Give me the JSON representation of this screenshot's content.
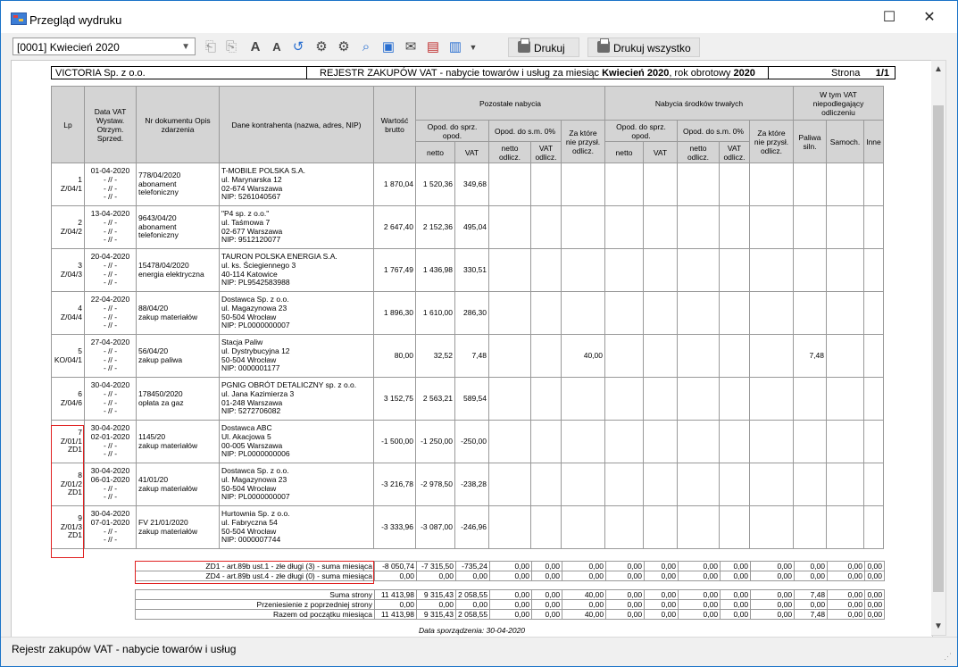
{
  "window": {
    "title": "Przegląd wydruku"
  },
  "toolbar": {
    "period_value": "[0001] Kwiecień 2020",
    "print_label": "Drukuj",
    "print_all_label": "Drukuj wszystko"
  },
  "report": {
    "company": "VICTORIA Sp. z o.o.",
    "title_prefix": "REJESTR ZAKUPÓW VAT - nabycie towarów i usług za miesiąc ",
    "title_month": "Kwiecień 2020",
    "title_mid": ", rok obrotowy ",
    "title_year": "2020",
    "page_label": "Strona",
    "page_value": "1/1",
    "headers": {
      "lp": "Lp",
      "date": "Data VAT Wystaw. Otrzym. Sprzed.",
      "doc": "Nr dokumentu Opis zdarzenia",
      "party": "Dane kontrahenta (nazwa, adres, NIP)",
      "gross": "Wartość brutto",
      "other": "Pozostałe nabycia",
      "assets": "Nabycia środków trwałych",
      "fuel_group": "W tym VAT niepodlegający odliczeniu",
      "opod": "Opod. do sprz. opod.",
      "sm0": "Opod. do s.m. 0%",
      "zakt": "Za które nie przysł. odlicz.",
      "netto": "netto",
      "vat": "VAT",
      "netto_odl": "netto odlicz.",
      "vat_odl": "VAT odlicz.",
      "paliwa": "Paliwa siln.",
      "samoch": "Samoch.",
      "inne": "Inne"
    },
    "rows": [
      {
        "lp": "1",
        "lp2": "Z/04/1",
        "lp3": "",
        "d1": "01-04-2020",
        "d2": "- // -",
        "d3": "- // -",
        "d4": "- // -",
        "doc": "778/04/2020",
        "desc1": "abonament",
        "desc2": "telefoniczny",
        "p1": "T-MOBILE POLSKA S.A.",
        "p2": "ul. Marynarska 12",
        "p3": "02-674 Warszawa",
        "p4": "NIP: 5261040567",
        "gross": "1 870,04",
        "netto": "1 520,36",
        "vat": "349,68",
        "zakt": "",
        "fuel": ""
      },
      {
        "lp": "2",
        "lp2": "Z/04/2",
        "lp3": "",
        "d1": "13-04-2020",
        "d2": "- // -",
        "d3": "- // -",
        "d4": "- // -",
        "doc": "9643/04/20",
        "desc1": "abonament",
        "desc2": "telefoniczny",
        "p1": "\"P4 sp. z o.o.\"",
        "p2": "ul. Taśmowa 7",
        "p3": "02-677 Warszawa",
        "p4": "NIP: 9512120077",
        "gross": "2 647,40",
        "netto": "2 152,36",
        "vat": "495,04",
        "zakt": "",
        "fuel": ""
      },
      {
        "lp": "3",
        "lp2": "Z/04/3",
        "lp3": "",
        "d1": "20-04-2020",
        "d2": "- // -",
        "d3": "- // -",
        "d4": "- // -",
        "doc": "15478/04/2020",
        "desc1": "energia elektryczna",
        "desc2": "",
        "p1": "TAURON POLSKA ENERGIA S.A.",
        "p2": "ul. ks. Ściegiennego 3",
        "p3": "40-114 Katowice",
        "p4": "NIP: PL9542583988",
        "gross": "1 767,49",
        "netto": "1 436,98",
        "vat": "330,51",
        "zakt": "",
        "fuel": ""
      },
      {
        "lp": "4",
        "lp2": "Z/04/4",
        "lp3": "",
        "d1": "22-04-2020",
        "d2": "- // -",
        "d3": "- // -",
        "d4": "- // -",
        "doc": "88/04/20",
        "desc1": "zakup materiałów",
        "desc2": "",
        "p1": "Dostawca Sp. z o.o.",
        "p2": "ul. Magazynowa 23",
        "p3": "50-504 Wrocław",
        "p4": "NIP: PL0000000007",
        "gross": "1 896,30",
        "netto": "1 610,00",
        "vat": "286,30",
        "zakt": "",
        "fuel": ""
      },
      {
        "lp": "5",
        "lp2": "KO/04/1",
        "lp3": "",
        "d1": "27-04-2020",
        "d2": "- // -",
        "d3": "- // -",
        "d4": "- // -",
        "doc": "56/04/20",
        "desc1": "zakup paliwa",
        "desc2": "",
        "p1": "Stacja Paliw",
        "p2": "ul. Dystrybucyjna 12",
        "p3": "50-504 Wrocław",
        "p4": "NIP: 0000001177",
        "gross": "80,00",
        "netto": "32,52",
        "vat": "7,48",
        "zakt": "40,00",
        "fuel": "7,48"
      },
      {
        "lp": "6",
        "lp2": "Z/04/6",
        "lp3": "",
        "d1": "30-04-2020",
        "d2": "- // -",
        "d3": "- // -",
        "d4": "- // -",
        "doc": "178450/2020",
        "desc1": "opłata za gaz",
        "desc2": "",
        "p1": "PGNIG OBRÓT DETALICZNY sp. z o.o.",
        "p2": "ul. Jana Kazimierza 3",
        "p3": "01-248 Warszawa",
        "p4": "NIP: 5272706082",
        "gross": "3 152,75",
        "netto": "2 563,21",
        "vat": "589,54",
        "zakt": "",
        "fuel": ""
      },
      {
        "lp": "7",
        "lp2": "Z/01/1",
        "lp3": "ZD1",
        "d1": "30-04-2020",
        "d2": "02-01-2020",
        "d3": "- // -",
        "d4": "- // -",
        "doc": "1145/20",
        "desc1": "zakup materiałów",
        "desc2": "",
        "p1": "Dostawca ABC",
        "p2": "Ul. Akacjowa 5",
        "p3": "00-005 Warszawa",
        "p4": "NIP: PL0000000006",
        "gross": "-1 500,00",
        "netto": "-1 250,00",
        "vat": "-250,00",
        "zakt": "",
        "fuel": ""
      },
      {
        "lp": "8",
        "lp2": "Z/01/2",
        "lp3": "ZD1",
        "d1": "30-04-2020",
        "d2": "06-01-2020",
        "d3": "- // -",
        "d4": "- // -",
        "doc": "41/01/20",
        "desc1": "zakup materiałów",
        "desc2": "",
        "p1": "Dostawca Sp. z o.o.",
        "p2": "ul. Magazynowa 23",
        "p3": "50-504 Wrocław",
        "p4": "NIP: PL0000000007",
        "gross": "-3 216,78",
        "netto": "-2 978,50",
        "vat": "-238,28",
        "zakt": "",
        "fuel": ""
      },
      {
        "lp": "9",
        "lp2": "Z/01/3",
        "lp3": "ZD1",
        "d1": "30-04-2020",
        "d2": "07-01-2020",
        "d3": "- // -",
        "d4": "- // -",
        "doc": "FV 21/01/2020",
        "desc1": "zakup materiałów",
        "desc2": "",
        "p1": "Hurtownia Sp. z o.o.",
        "p2": "ul. Fabryczna 54",
        "p3": "50-504 Wrocław",
        "p4": "NIP: 0000007744",
        "gross": "-3 333,96",
        "netto": "-3 087,00",
        "vat": "-246,96",
        "zakt": "",
        "fuel": ""
      }
    ],
    "zd_rows": [
      {
        "label": "ZD1 - art.89b ust.1 - złe długi (3) - suma miesiąca",
        "vals": [
          "-8 050,74",
          "-7 315,50",
          "-735,24",
          "0,00",
          "0,00",
          "0,00",
          "0,00",
          "0,00",
          "0,00",
          "0,00",
          "0,00",
          "0,00",
          "0,00",
          "0,00"
        ]
      },
      {
        "label": "ZD4 - art.89b ust.4 - złe długi (0) - suma miesiąca",
        "vals": [
          "0,00",
          "0,00",
          "0,00",
          "0,00",
          "0,00",
          "0,00",
          "0,00",
          "0,00",
          "0,00",
          "0,00",
          "0,00",
          "0,00",
          "0,00",
          "0,00"
        ]
      }
    ],
    "sum_rows": [
      {
        "label": "Suma strony",
        "vals": [
          "11 413,98",
          "9 315,43",
          "2 058,55",
          "0,00",
          "0,00",
          "40,00",
          "0,00",
          "0,00",
          "0,00",
          "0,00",
          "0,00",
          "7,48",
          "0,00",
          "0,00"
        ]
      },
      {
        "label": "Przeniesienie z poprzedniej strony",
        "vals": [
          "0,00",
          "0,00",
          "0,00",
          "0,00",
          "0,00",
          "0,00",
          "0,00",
          "0,00",
          "0,00",
          "0,00",
          "0,00",
          "0,00",
          "0,00",
          "0,00"
        ]
      },
      {
        "label": "Razem od początku miesiąca",
        "vals": [
          "11 413,98",
          "9 315,43",
          "2 058,55",
          "0,00",
          "0,00",
          "40,00",
          "0,00",
          "0,00",
          "0,00",
          "0,00",
          "0,00",
          "7,48",
          "0,00",
          "0,00"
        ]
      }
    ],
    "footer_date": "Data sporządzenia: 30-04-2020"
  },
  "status": {
    "text": "Rejestr zakupów VAT - nabycie towarów i usług"
  }
}
